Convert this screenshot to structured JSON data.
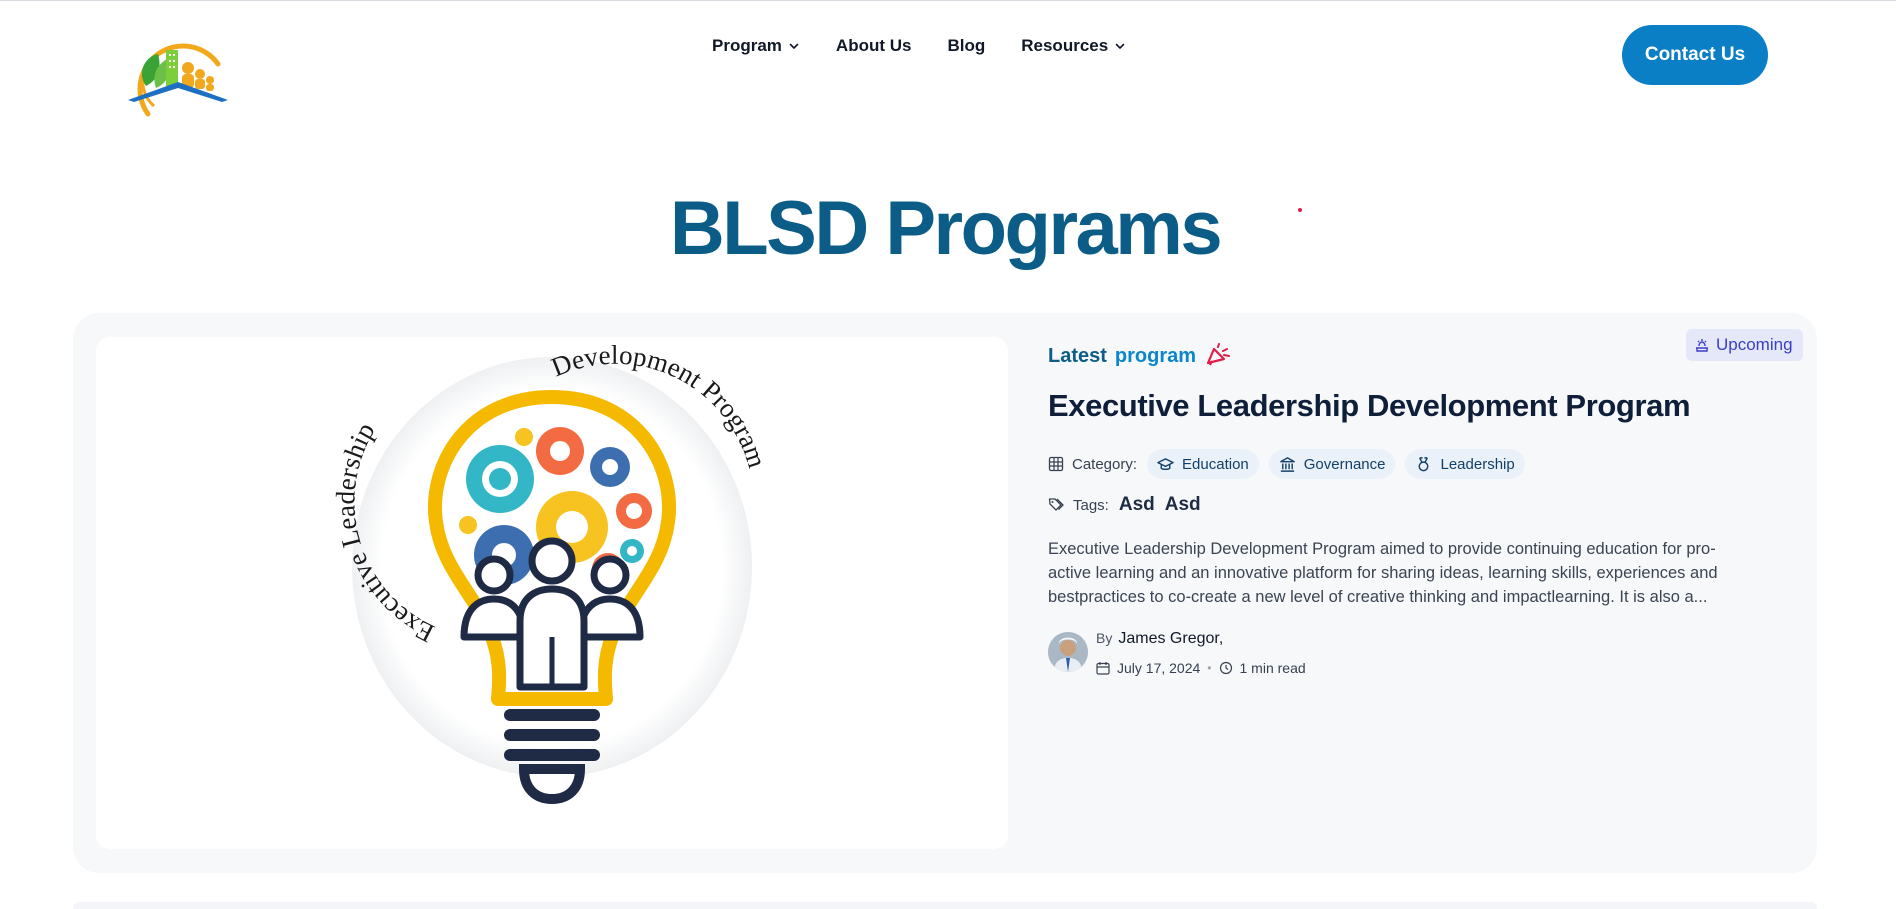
{
  "header": {
    "nav": [
      {
        "label": "Program",
        "has_dropdown": true
      },
      {
        "label": "About Us",
        "has_dropdown": false
      },
      {
        "label": "Blog",
        "has_dropdown": false
      },
      {
        "label": "Resources",
        "has_dropdown": true
      }
    ],
    "contact_label": "Contact Us"
  },
  "page": {
    "title": "BLSD Programs"
  },
  "program": {
    "status_badge": "Upcoming",
    "latest_word1": "Latest",
    "latest_word2": "program",
    "title": "Executive Leadership Development Program",
    "category_label": "Category:",
    "categories": [
      {
        "label": "Education",
        "icon": "graduation-cap-icon"
      },
      {
        "label": "Governance",
        "icon": "bank-icon"
      },
      {
        "label": "Leadership",
        "icon": "award-icon"
      }
    ],
    "tags_label": "Tags:",
    "tags": [
      "Asd",
      "Asd"
    ],
    "excerpt": "Executive Leadership Development Program aimed to provide continuing education for pro-active learning and an innovative platform for sharing ideas, learning skills, experiences and bestpractices to co-create a new level of creative thinking and impactlearning. It is also a...",
    "by_label": "By",
    "author": "James Gregor,",
    "date": "July 17, 2024",
    "read_time": "1 min read",
    "image_text_arc_left": "Executive Leadership",
    "image_text_arc_right": "Development Program"
  },
  "colors": {
    "brand_blue": "#0a7fc6",
    "title_blue": "#0b5c86",
    "badge_purple": "#3b3fc4",
    "bulb_yellow": "#f5b900"
  }
}
